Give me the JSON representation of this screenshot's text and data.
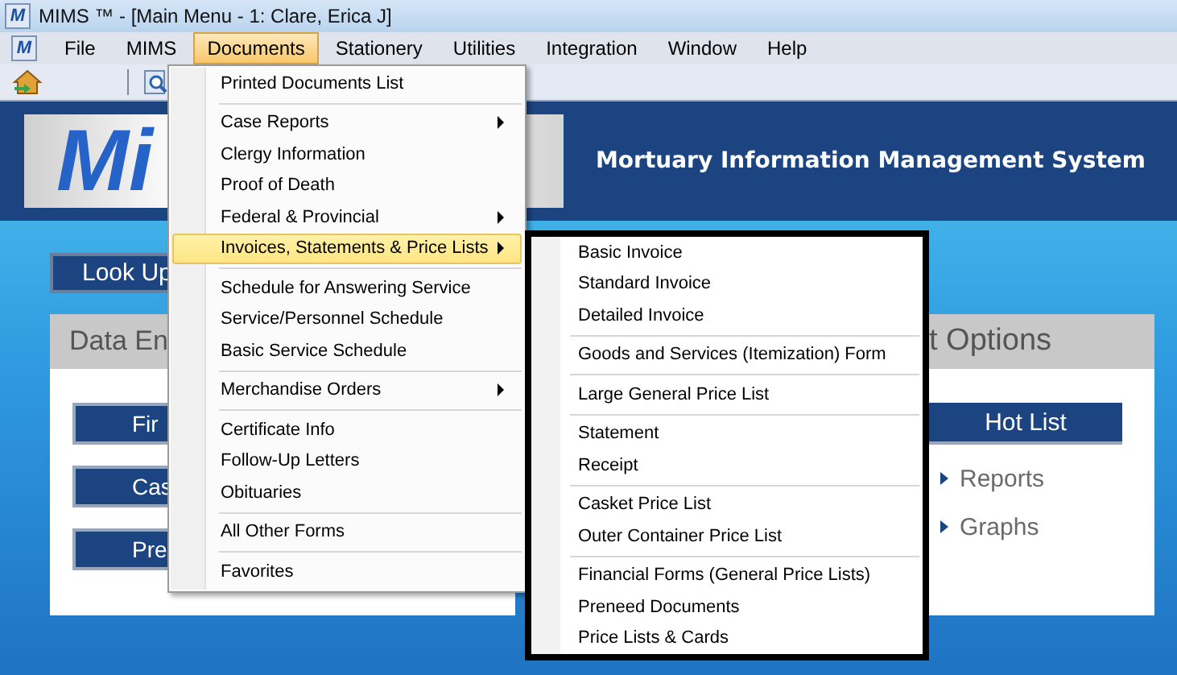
{
  "window": {
    "icon": "M",
    "title": "MIMS ™ - [Main Menu - 1: Clare, Erica J]"
  },
  "menu_bar_icon": "M",
  "menu_bar": [
    {
      "label": "File",
      "selected": false
    },
    {
      "label": "MIMS",
      "selected": false
    },
    {
      "label": "Documents",
      "selected": true
    },
    {
      "label": "Stationery",
      "selected": false
    },
    {
      "label": "Utilities",
      "selected": false
    },
    {
      "label": "Integration",
      "selected": false
    },
    {
      "label": "Window",
      "selected": false
    },
    {
      "label": "Help",
      "selected": false
    }
  ],
  "header": {
    "logo": "Mi",
    "title": "Mortuary Information Management System"
  },
  "look_up_button": "Look Up",
  "data_entry_panel": {
    "title": "Data En",
    "buttons": [
      "Fir",
      "Cas",
      "Pre"
    ]
  },
  "options_panel": {
    "title": "t Options",
    "button": "Hot List",
    "links": [
      "Reports",
      "Graphs"
    ]
  },
  "documents_menu": {
    "groups": [
      [
        {
          "label": "Printed Documents List",
          "submenu": false,
          "selected": false
        }
      ],
      [
        {
          "label": "Case Reports",
          "submenu": true,
          "selected": false
        },
        {
          "label": "Clergy Information",
          "submenu": false,
          "selected": false
        },
        {
          "label": "Proof of Death",
          "submenu": false,
          "selected": false
        },
        {
          "label": "Federal & Provincial",
          "submenu": true,
          "selected": false
        },
        {
          "label": "Invoices, Statements & Price Lists",
          "submenu": true,
          "selected": true
        }
      ],
      [
        {
          "label": "Schedule for Answering Service",
          "submenu": false,
          "selected": false
        },
        {
          "label": "Service/Personnel Schedule",
          "submenu": false,
          "selected": false
        },
        {
          "label": "Basic Service Schedule",
          "submenu": false,
          "selected": false
        }
      ],
      [
        {
          "label": "Merchandise Orders",
          "submenu": true,
          "selected": false
        }
      ],
      [
        {
          "label": "Certificate Info",
          "submenu": false,
          "selected": false
        },
        {
          "label": "Follow-Up Letters",
          "submenu": false,
          "selected": false
        },
        {
          "label": "Obituaries",
          "submenu": false,
          "selected": false
        }
      ],
      [
        {
          "label": "All Other Forms",
          "submenu": false,
          "selected": false
        }
      ],
      [
        {
          "label": "Favorites",
          "submenu": false,
          "selected": false
        }
      ]
    ]
  },
  "invoices_submenu": {
    "groups": [
      [
        {
          "label": "Basic Invoice"
        },
        {
          "label": "Standard Invoice"
        },
        {
          "label": "Detailed Invoice"
        }
      ],
      [
        {
          "label": "Goods and Services (Itemization) Form"
        }
      ],
      [
        {
          "label": "Large General Price List"
        }
      ],
      [
        {
          "label": "Statement"
        },
        {
          "label": "Receipt"
        }
      ],
      [
        {
          "label": "Casket Price List"
        },
        {
          "label": "Outer Container Price List"
        }
      ],
      [
        {
          "label": "Financial Forms (General Price Lists)"
        },
        {
          "label": "Preneed Documents"
        },
        {
          "label": "Price Lists & Cards"
        }
      ]
    ]
  }
}
